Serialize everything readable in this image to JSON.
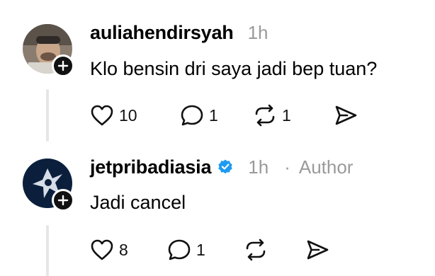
{
  "posts": [
    {
      "username": "auliahendirsyah",
      "time": "1h",
      "verified": false,
      "author_label": "",
      "text": "Klo bensin dri saya jadi bep tuan?",
      "likes": "10",
      "replies": "1",
      "reposts": "1"
    },
    {
      "username": "jetpribadiasia",
      "time": "1h",
      "verified": true,
      "author_separator": "·",
      "author_label": "Author",
      "text": "Jadi cancel",
      "likes": "8",
      "replies": "1",
      "reposts": ""
    }
  ],
  "icons": {
    "like": "heart-icon",
    "reply": "comment-icon",
    "repost": "repost-icon",
    "share": "send-icon",
    "follow": "plus-icon",
    "verified": "verified-badge-icon"
  },
  "colors": {
    "verified": "#1d9bf0",
    "muted": "#9a9a9a",
    "thread_line": "#e6e6e6"
  }
}
